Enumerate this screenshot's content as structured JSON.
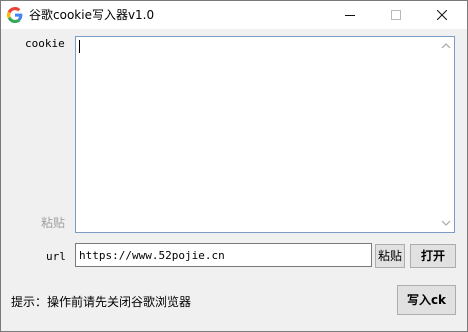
{
  "window": {
    "title": "谷歌cookie写入器v1.0",
    "app_icon": "google-g-icon"
  },
  "titlebar_buttons": {
    "minimize_icon": "minimize-icon",
    "maximize_icon": "maximize-icon",
    "close_icon": "close-icon"
  },
  "cookie": {
    "label": "cookie",
    "value": "",
    "paste_hint": "粘贴"
  },
  "url": {
    "label": "url",
    "value": "https://www.52pojie.cn"
  },
  "buttons": {
    "paste": "粘贴",
    "open": "打开",
    "write": "写入ck"
  },
  "hint": "提示：操作前请先关闭谷歌浏览器",
  "colors": {
    "google_blue": "#4285F4",
    "google_red": "#EA4335",
    "google_yellow": "#FBBC05",
    "google_green": "#34A853",
    "focus_border": "#7a9cc6"
  }
}
